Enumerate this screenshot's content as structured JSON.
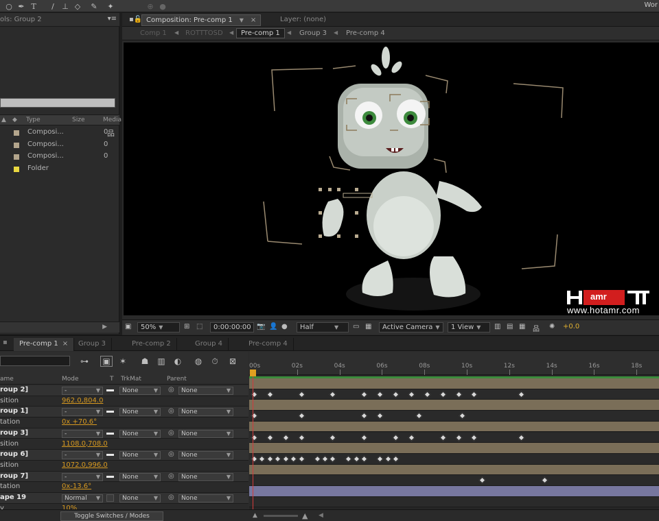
{
  "workspace_label": "Wor",
  "toolbar_icons": [
    "ellipse-tool-icon",
    "pen-tool-icon",
    "text-tool-icon",
    "brush-tool-icon",
    "clone-stamp-icon",
    "eraser-tool-icon",
    "roto-brush-icon",
    "puppet-pin-icon",
    "snap-icon"
  ],
  "project": {
    "tab_label": "ols: Group 2",
    "columns": {
      "type": "Type",
      "size": "Size",
      "media": "Media"
    },
    "items": [
      {
        "name": "Composi...",
        "num": "0",
        "color": "#b3a58c"
      },
      {
        "name": "Composi...",
        "num": "0",
        "color": "#b3a58c"
      },
      {
        "name": "Composi...",
        "num": "0",
        "color": "#b3a58c"
      },
      {
        "name": "Folder",
        "num": "",
        "color": "#e8d740"
      }
    ]
  },
  "composition": {
    "tab_label": "Composition: Pre-comp 1",
    "layer_tab_label": "Layer: (none)",
    "flowchart": [
      "Comp 1",
      "ROTTTOSD",
      "Pre-comp 1",
      "Group 3",
      "Pre-comp 4"
    ],
    "flowchart_active": "Pre-comp 1",
    "footer": {
      "zoom": "50%",
      "timecode": "0:00:00:00",
      "resolution": "Half",
      "camera": "Active Camera",
      "views": "1 View",
      "exposure": "+0.0"
    }
  },
  "watermark": {
    "logo_text": "amr",
    "url": "www.hotamr.com"
  },
  "timeline": {
    "tabs": [
      "Pre-comp 1",
      "Group 3",
      "Pre-comp 2",
      "Group 4",
      "Pre-comp 4"
    ],
    "active_tab": "Pre-comp 1",
    "columns": {
      "name": "ame",
      "mode": "Mode",
      "t": "T",
      "trkmat": "TrkMat",
      "parent": "Parent"
    },
    "ruler": [
      "00s",
      "02s",
      "04s",
      "06s",
      "08s",
      "10s",
      "12s",
      "14s",
      "16s",
      "18s"
    ],
    "rows": [
      {
        "kind": "layer",
        "name": "roup 2]",
        "mode": "-",
        "trkmat": "None",
        "parent": "None"
      },
      {
        "kind": "prop",
        "name": "sition",
        "value": "962.0,804.0",
        "keys": [
          0,
          2,
          6,
          10,
          14,
          16,
          18,
          20,
          22,
          24,
          26,
          28,
          34
        ]
      },
      {
        "kind": "layer",
        "name": "roup 1]",
        "mode": "-",
        "trkmat": "None",
        "parent": "None"
      },
      {
        "kind": "prop",
        "name": "tation",
        "value": "0x +70.6°",
        "keys": [
          0,
          6,
          14,
          16,
          21,
          26.5
        ]
      },
      {
        "kind": "layer",
        "name": "roup 3]",
        "mode": "-",
        "trkmat": "None",
        "parent": "None"
      },
      {
        "kind": "prop",
        "name": "sition",
        "value": "1108.0,708.0",
        "keys": [
          0,
          2,
          4,
          6,
          10,
          14,
          18,
          20,
          24,
          26,
          28,
          34
        ]
      },
      {
        "kind": "layer",
        "name": "roup 6]",
        "mode": "-",
        "trkmat": "None",
        "parent": "None"
      },
      {
        "kind": "prop",
        "name": "sition",
        "value": "1072.0,996.0",
        "keys": [
          0,
          1,
          2,
          3,
          4,
          5,
          6,
          8,
          9,
          10,
          12,
          13,
          14,
          16,
          17,
          18
        ]
      },
      {
        "kind": "layer",
        "name": "roup 7]",
        "mode": "-",
        "trkmat": "None",
        "parent": "None"
      },
      {
        "kind": "prop",
        "name": "tation",
        "value": "0x-13.6°",
        "keys": [
          29,
          37
        ]
      },
      {
        "kind": "layer",
        "name": "ape 19",
        "mode": "Normal",
        "trkmat": "None",
        "parent": "None",
        "shape": true
      },
      {
        "kind": "prop",
        "name": "y",
        "value": "10%",
        "keys": []
      }
    ],
    "toggle_label": "Toggle Switches / Modes"
  }
}
